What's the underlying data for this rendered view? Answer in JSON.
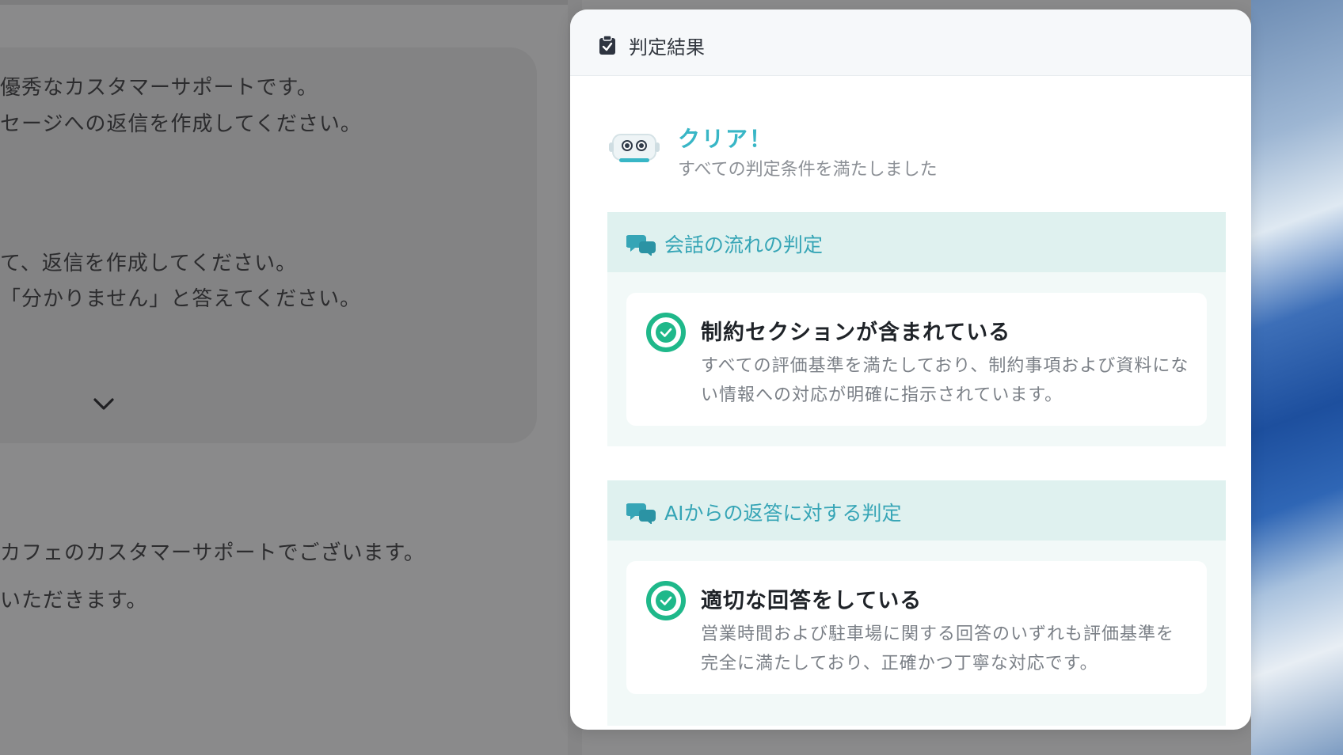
{
  "background": {
    "prompt_lines": [
      "優秀なカスタマーサポートです。",
      "セージへの返信を作成してください。",
      "て、返信を作成してください。",
      "「分かりません」と答えてください。"
    ],
    "reply_lines": [
      "カフェのカスタマーサポートでございます。",
      "いただきます。"
    ],
    "expand_icon": "chevron-down-icon"
  },
  "modal": {
    "header_icon": "clipboard-check-icon",
    "header_title": "判定結果",
    "result": {
      "icon": "robot-icon",
      "title": "クリア！",
      "subtitle": "すべての判定条件を満たしました"
    },
    "sections": [
      {
        "icon": "chat-bubbles-icon",
        "title": "会話の流れの判定",
        "item": {
          "status_icon": "check-circle-icon",
          "title": "制約セクションが含まれている",
          "description": "すべての評価基準を満たしており、制約事項および資料にない情報への対応が明確に指示されています。"
        }
      },
      {
        "icon": "chat-bubbles-icon",
        "title": "AIからの返答に対する判定",
        "item": {
          "status_icon": "check-circle-icon",
          "title": "適切な回答をしている",
          "description": "営業時間および駐車場に関する回答のいずれも評価基準を完全に満たしており、正確かつ丁寧な対応です。"
        }
      }
    ]
  },
  "colors": {
    "accent_teal": "#38b6c6",
    "success_green": "#1fb88a",
    "section_header_bg": "#dff1ef"
  }
}
